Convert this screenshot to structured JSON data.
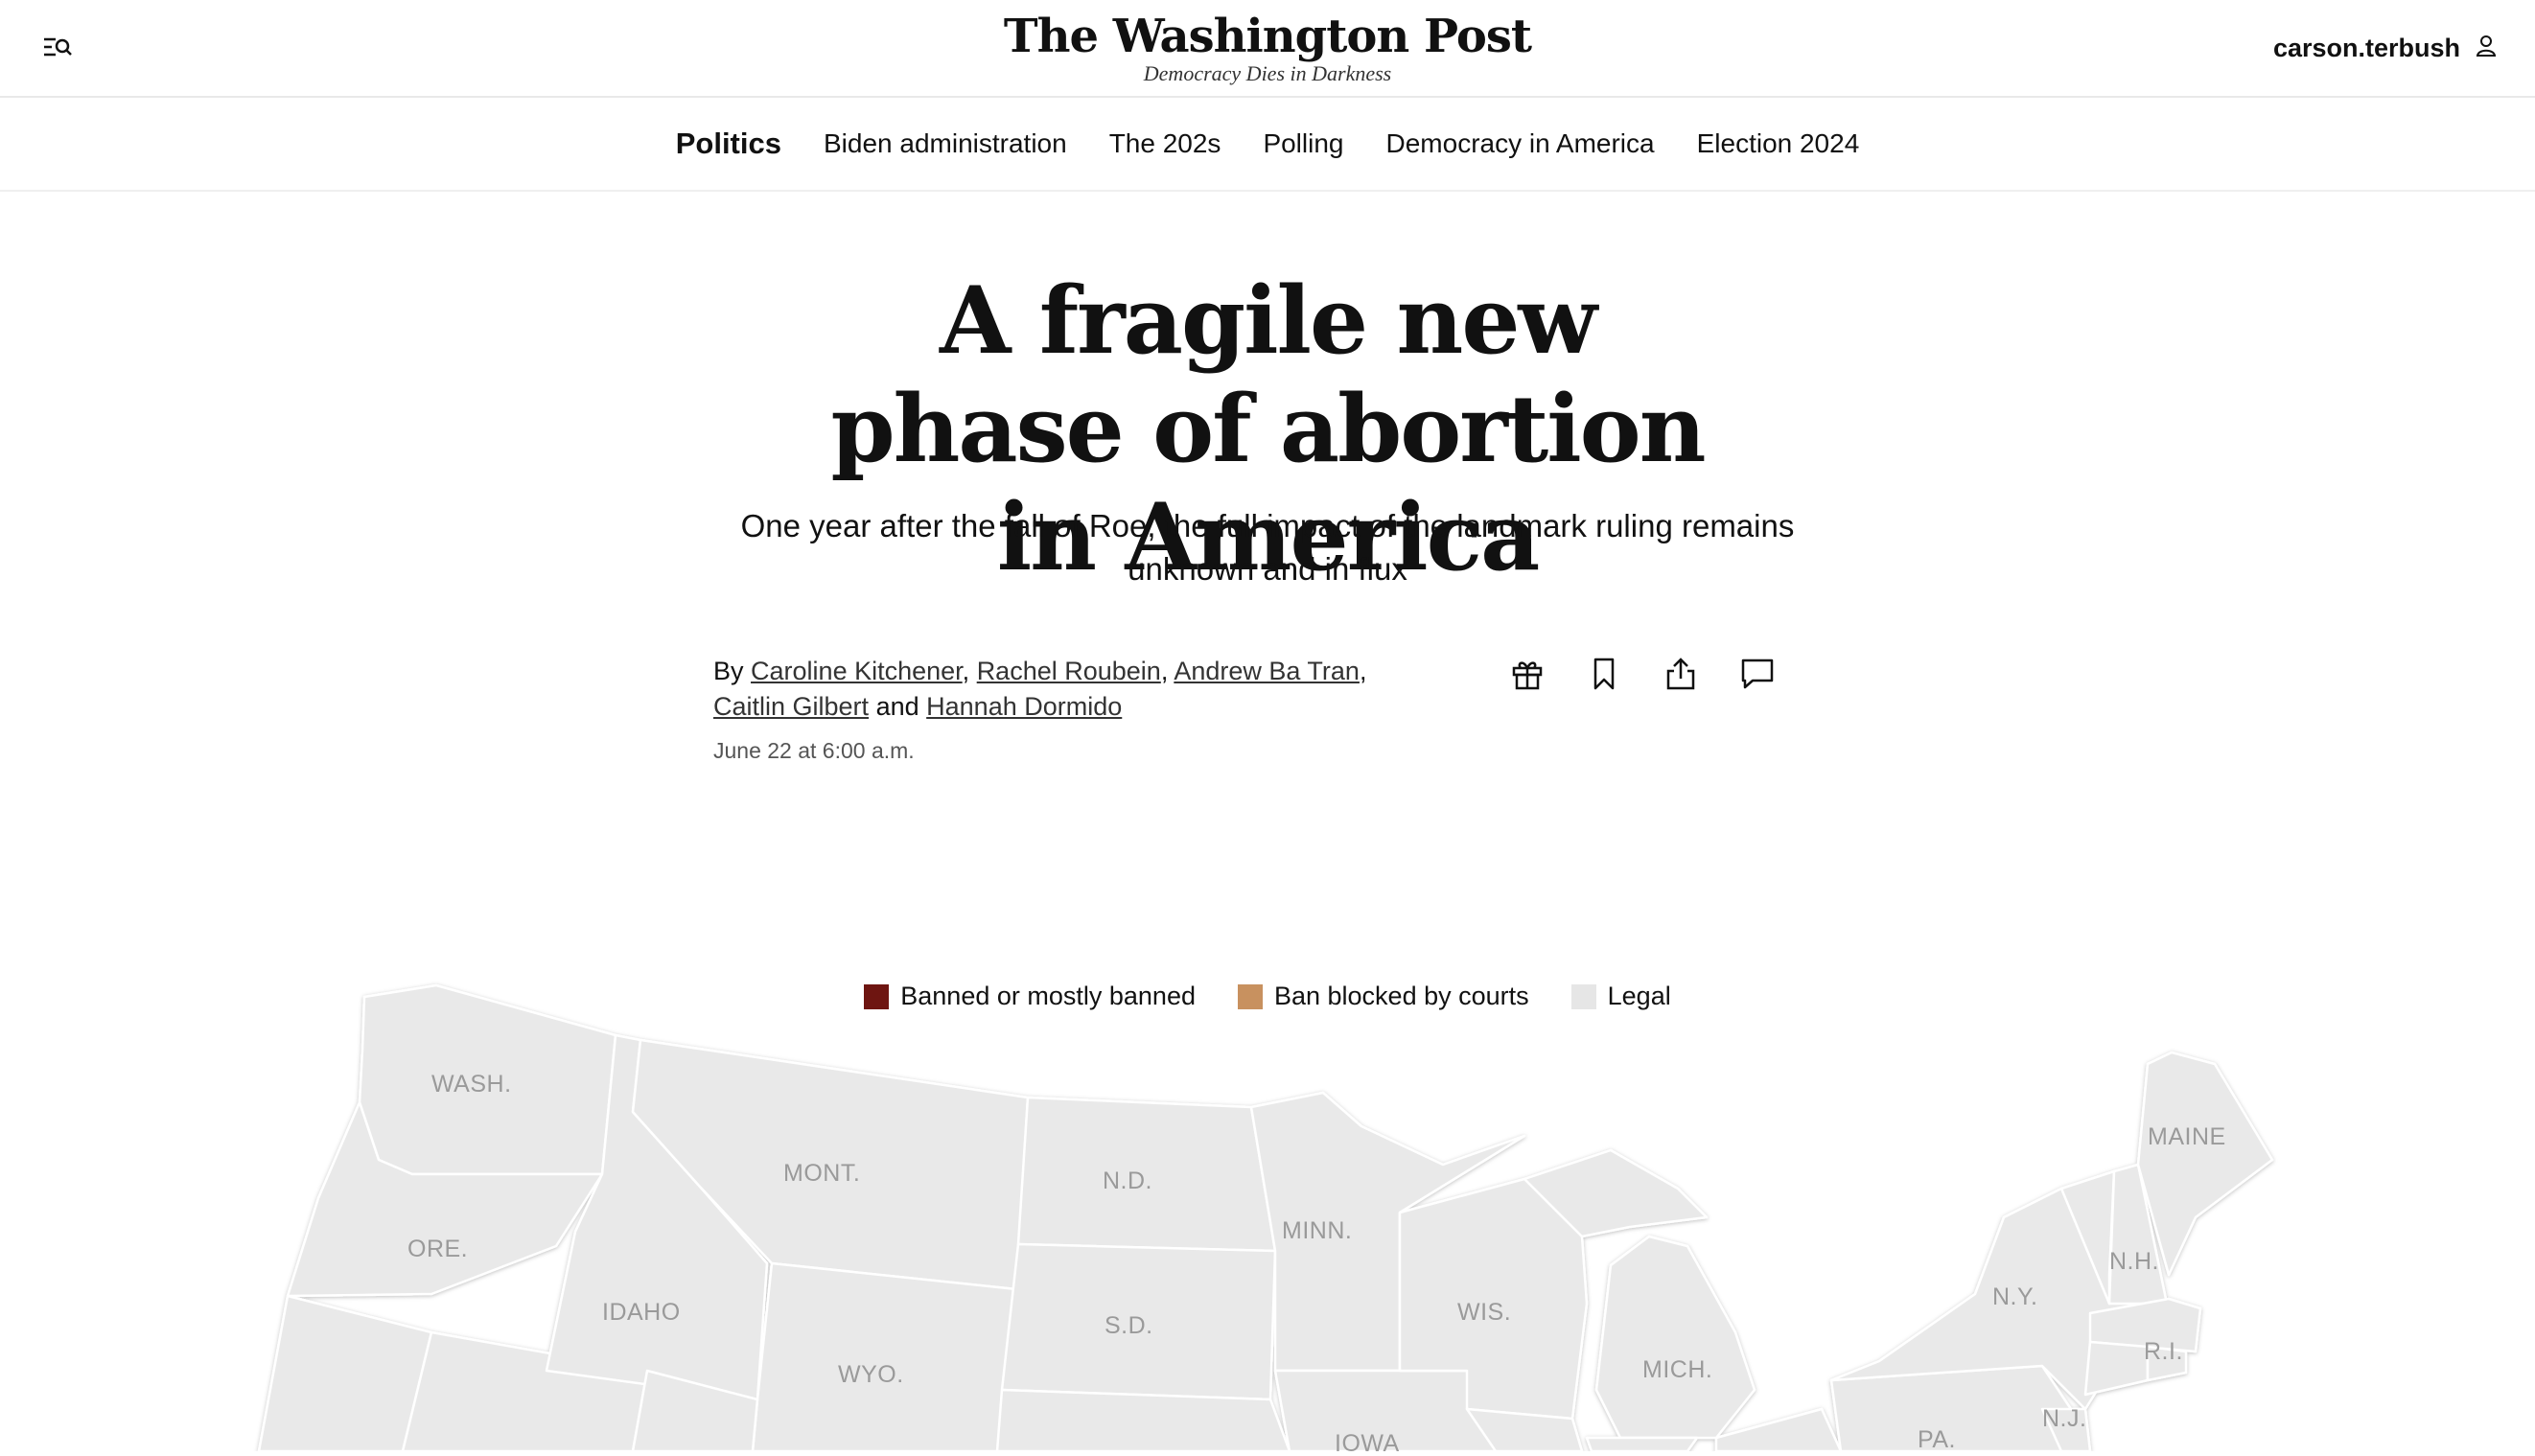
{
  "header": {
    "logo": "The Washington Post",
    "tagline": "Democracy Dies in Darkness",
    "username": "carson.terbush",
    "menu_icon": "menu-search-icon",
    "user_icon": "user-icon"
  },
  "nav": {
    "section": "Politics",
    "items": [
      "Biden administration",
      "The 202s",
      "Polling",
      "Democracy in America",
      "Election 2024"
    ]
  },
  "article": {
    "headline": "A fragile new phase of abortion in America",
    "dek": "One year after the fall of Roe, the full impact of the landmark ruling remains unknown and in flux",
    "by": "By",
    "authors": [
      "Caroline Kitchener",
      "Rachel Roubein",
      "Andrew Ba Tran",
      "Caitlin Gilbert",
      "Hannah Dormido"
    ],
    "and": "and",
    "date": "June 22 at 6:00 a.m.",
    "actions": [
      "gift-icon",
      "bookmark-icon",
      "share-icon",
      "comment-icon"
    ]
  },
  "legend": {
    "items": [
      {
        "label": "Banned or mostly banned",
        "color": "#6e1511"
      },
      {
        "label": "Ban blocked by courts",
        "color": "#c8915f"
      },
      {
        "label": "Legal",
        "color": "#e6e6e6"
      }
    ]
  },
  "map": {
    "fill": "#e9e9e9",
    "stroke": "#ffffff",
    "states": [
      "WASH.",
      "MONT.",
      "N.D.",
      "MINN.",
      "MAINE",
      "ORE.",
      "IDAHO",
      "S.D.",
      "WIS.",
      "N.Y.",
      "N.H.",
      "WYO.",
      "MICH.",
      "R.I.",
      "IOWA",
      "PA.",
      "N.J."
    ]
  }
}
